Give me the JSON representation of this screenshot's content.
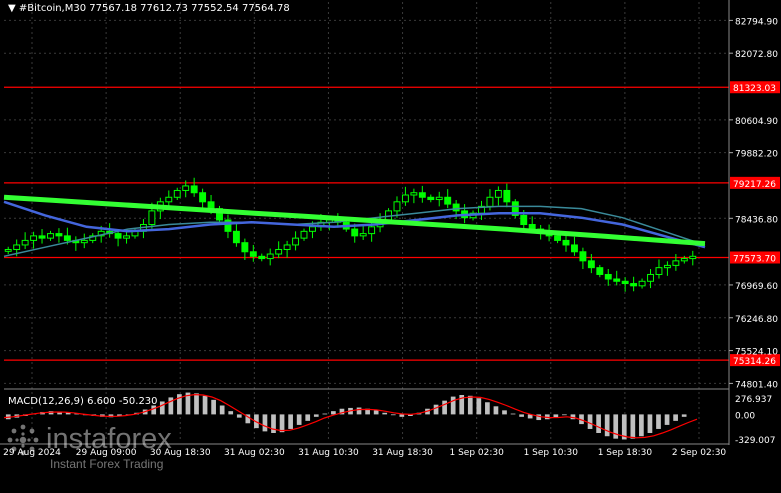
{
  "header": {
    "arrow": "▼",
    "symbol": "#Bitcoin,M30",
    "ohlc": "77567.18 77612.73 77552.54 77564.78"
  },
  "macd": {
    "label": "MACD(12,26,9) 6.600 -50.230",
    "axis_labels": [
      "276.937",
      "0.00",
      "-329.007"
    ]
  },
  "brand": {
    "name": "instaforex",
    "tagline": "Instant Forex Trading",
    "icon": "circular-dots-logo-icon"
  },
  "colors": {
    "background": "#000000",
    "grid": "#3a3a3a",
    "price_line": "#ff0000",
    "candles": "#00ff00",
    "slow_ma": "#33ff33",
    "blue_ma": "#4466dd",
    "teal_ma": "#3a8a9a",
    "macd_hist": "#c0c0c0",
    "macd_signal": "#ff0000"
  },
  "chart_data": [
    {
      "type": "candlestick",
      "title": "#Bitcoin,M30",
      "y_axis_labels": [
        "82794.90",
        "82072.80",
        "80604.90",
        "79882.20",
        "78436.80",
        "76969.60",
        "76246.80",
        "75524.10",
        "74801.40"
      ],
      "x_axis_labels": [
        "29 Aug 2024",
        "29 Aug 09:00",
        "30 Aug 18:30",
        "31 Aug 02:30",
        "31 Aug 10:30",
        "31 Aug 18:30",
        "1 Sep 02:30",
        "1 Sep 10:30",
        "1 Sep 18:30",
        "2 Sep 02:30"
      ],
      "ylim": [
        74700,
        83200
      ],
      "horizontal_levels": [
        {
          "value": 81323.03,
          "label": "81323.03"
        },
        {
          "value": 79217.26,
          "label": "79217.26"
        },
        {
          "value": 77573.7,
          "label": "77573.70"
        },
        {
          "value": 75314.26,
          "label": "75314.26"
        }
      ],
      "close_series": [
        77750,
        77850,
        77950,
        78050,
        78000,
        78100,
        78050,
        77950,
        77900,
        77950,
        78050,
        78150,
        78100,
        78000,
        78050,
        78150,
        78300,
        78600,
        78800,
        78900,
        79050,
        79150,
        79000,
        78800,
        78650,
        78400,
        78150,
        77900,
        77700,
        77600,
        77550,
        77650,
        77750,
        77850,
        78000,
        78150,
        78250,
        78350,
        78400,
        78350,
        78200,
        78050,
        78100,
        78250,
        78400,
        78600,
        78800,
        78950,
        79000,
        78900,
        78850,
        78900,
        78750,
        78600,
        78450,
        78550,
        78700,
        78900,
        79050,
        78800,
        78500,
        78300,
        78200,
        78150,
        78050,
        77950,
        77850,
        77700,
        77500,
        77350,
        77200,
        77100,
        77050,
        77000,
        76950,
        77050,
        77200,
        77350,
        77400,
        77500,
        77550,
        77600
      ],
      "slow_ma_series": [
        78900,
        78830,
        78760,
        78690,
        78620,
        78550,
        78480,
        78410,
        78340,
        78270,
        78200,
        78120,
        78040,
        77960,
        77880
      ],
      "blue_ma_series": [
        78800,
        78500,
        78250,
        78150,
        78200,
        78300,
        78350,
        78300,
        78250,
        78300,
        78400,
        78500,
        78550,
        78550,
        78450,
        78300,
        78050,
        77800
      ],
      "teal_ma_series": [
        77600,
        77800,
        78000,
        78200,
        78300,
        78350,
        78350,
        78300,
        78350,
        78450,
        78550,
        78650,
        78700,
        78700,
        78650,
        78450,
        78150,
        77850
      ]
    },
    {
      "type": "bar",
      "title": "MACD(12,26,9) 6.600 -50.230",
      "ylim": [
        -329.007,
        276.937
      ],
      "histogram": [
        -60,
        -40,
        -20,
        10,
        30,
        40,
        35,
        25,
        10,
        -10,
        -20,
        -30,
        -35,
        -25,
        -10,
        20,
        60,
        110,
        160,
        210,
        250,
        270,
        260,
        230,
        180,
        110,
        40,
        -40,
        -110,
        -170,
        -210,
        -230,
        -220,
        -180,
        -130,
        -80,
        -30,
        10,
        40,
        70,
        80,
        85,
        70,
        50,
        20,
        -10,
        -30,
        -20,
        20,
        70,
        120,
        170,
        220,
        240,
        230,
        200,
        150,
        100,
        50,
        10,
        -30,
        -50,
        -70,
        -60,
        -40,
        -10,
        -60,
        -120,
        -180,
        -230,
        -270,
        -300,
        -310,
        -300,
        -270,
        -230,
        -180,
        -130,
        -80,
        -30,
        0
      ],
      "signal": [
        -40,
        -30,
        -15,
        0,
        15,
        25,
        30,
        28,
        20,
        5,
        -8,
        -18,
        -25,
        -24,
        -15,
        0,
        25,
        60,
        100,
        150,
        195,
        230,
        245,
        240,
        215,
        170,
        110,
        45,
        -20,
        -85,
        -140,
        -180,
        -200,
        -195,
        -170,
        -130,
        -90,
        -45,
        -10,
        20,
        45,
        60,
        62,
        55,
        40,
        20,
        5,
        0,
        15,
        45,
        85,
        130,
        175,
        205,
        215,
        210,
        185,
        150,
        110,
        65,
        25,
        -5,
        -30,
        -40,
        -38,
        -30,
        -45,
        -80,
        -125,
        -175,
        -220,
        -255,
        -280,
        -290,
        -285,
        -265,
        -230,
        -190,
        -145,
        -100,
        -60
      ]
    }
  ]
}
